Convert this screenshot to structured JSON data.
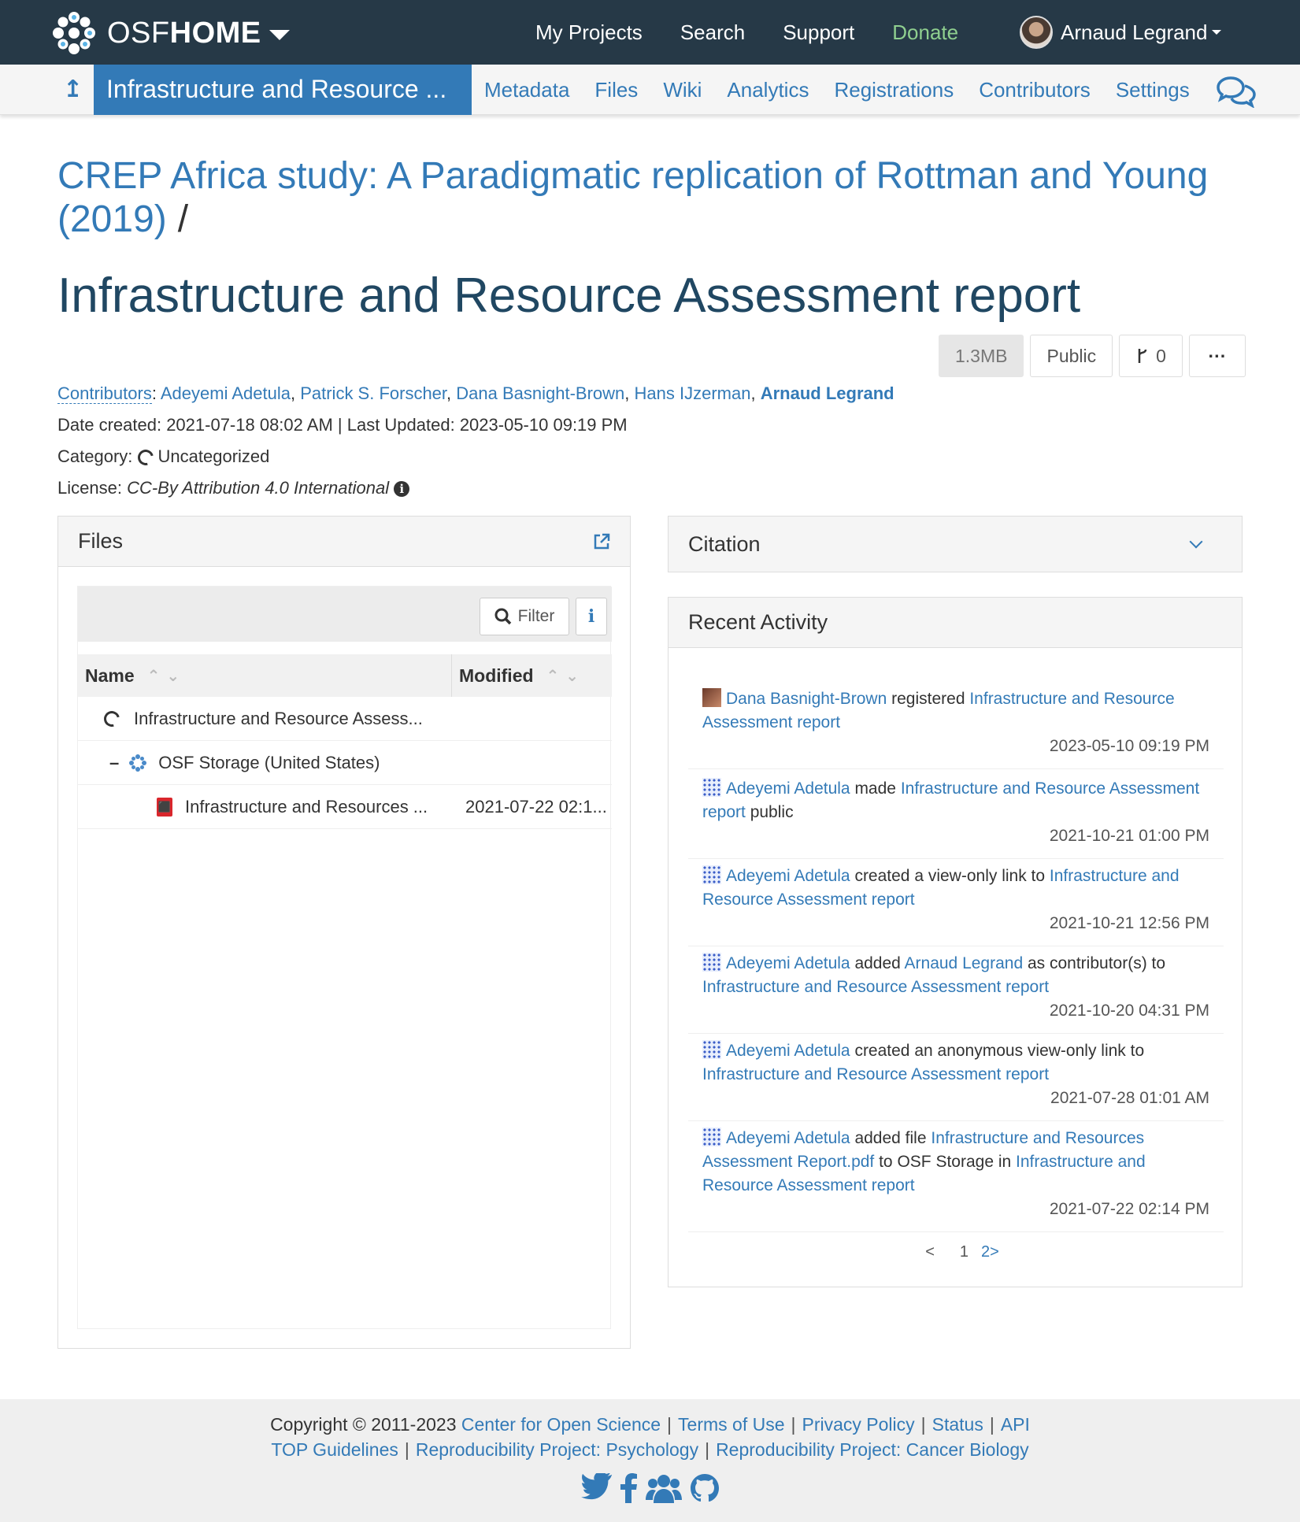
{
  "navbar": {
    "brand_osf": "OSF",
    "brand_home": "HOME",
    "items": [
      "My Projects",
      "Search",
      "Support",
      "Donate"
    ],
    "user_name": "Arnaud Legrand"
  },
  "subnav": {
    "current": "Infrastructure and Resource ...",
    "items": [
      "Metadata",
      "Files",
      "Wiki",
      "Analytics",
      "Registrations",
      "Contributors",
      "Settings"
    ]
  },
  "parent_title": "CREP Africa study: A Paradigmatic replication of Rottman and Young (2019)",
  "parent_slash": "/",
  "page_title": "Infrastructure and Resource Assessment report",
  "buttons": {
    "size": "1.3MB",
    "visibility": "Public",
    "forks": "0",
    "more": "···"
  },
  "meta": {
    "contributors_label": "Contributors",
    "contributors": [
      "Adeyemi Adetula",
      "Patrick S. Forscher",
      "Dana Basnight-Brown",
      "Hans IJzerman",
      "Arnaud Legrand"
    ],
    "dates": "Date created: 2021-07-18 08:02 AM | Last Updated: 2023-05-10 09:19 PM",
    "category_label": "Category:",
    "category": "Uncategorized",
    "license_label": "License:",
    "license": "CC-By Attribution 4.0 International"
  },
  "files": {
    "title": "Files",
    "filter": "Filter",
    "col_name": "Name",
    "col_modified": "Modified",
    "rows": [
      {
        "name": "Infrastructure and Resource Assess...",
        "modified": ""
      },
      {
        "name": "OSF Storage (United States)",
        "modified": ""
      },
      {
        "name": "Infrastructure and Resources ...",
        "modified": "2021-07-22 02:1..."
      }
    ]
  },
  "citation": {
    "title": "Citation"
  },
  "activity": {
    "title": "Recent Activity",
    "entries": [
      {
        "user": "Dana Basnight-Brown",
        "t1": " registered ",
        "l1": "Infrastructure and Resource Assessment report",
        "t2": "",
        "l2": "",
        "t3": "",
        "l3": "",
        "time": "2023-05-10 09:19 PM"
      },
      {
        "user": "Adeyemi Adetula",
        "t1": " made ",
        "l1": "Infrastructure and Resource Assessment report",
        "t2": " public",
        "l2": "",
        "t3": "",
        "l3": "",
        "time": "2021-10-21 01:00 PM"
      },
      {
        "user": "Adeyemi Adetula",
        "t1": " created a view-only link to ",
        "l1": "Infrastructure and Resource Assessment report",
        "t2": "",
        "l2": "",
        "t3": "",
        "l3": "",
        "time": "2021-10-21 12:56 PM"
      },
      {
        "user": "Adeyemi Adetula",
        "t1": " added ",
        "l1": "Arnaud Legrand",
        "t2": " as contributor(s) to ",
        "l2": "Infrastructure and Resource Assessment report",
        "t3": "",
        "l3": "",
        "time": "2021-10-20 04:31 PM"
      },
      {
        "user": "Adeyemi Adetula",
        "t1": " created an anonymous view-only link to ",
        "l1": "Infrastructure and Resource Assessment report",
        "t2": "",
        "l2": "",
        "t3": "",
        "l3": "",
        "time": "2021-07-28 01:01 AM"
      },
      {
        "user": "Adeyemi Adetula",
        "t1": " added file ",
        "l1": "Infrastructure and Resources Assessment Report.pdf",
        "t2": " to OSF Storage in ",
        "l2": "Infrastructure and Resource Assessment report",
        "t3": "",
        "l3": "",
        "time": "2021-07-22 02:14 PM"
      }
    ],
    "pager": {
      "prev": "<",
      "p1": "1",
      "p2": "2",
      "next": ">"
    }
  },
  "footer": {
    "copyright": "Copyright © 2011-2023",
    "links1": [
      "Center for Open Science",
      "Terms of Use",
      "Privacy Policy",
      "Status",
      "API"
    ],
    "links2": [
      "TOP Guidelines",
      "Reproducibility Project: Psychology",
      "Reproducibility Project: Cancer Biology"
    ]
  }
}
